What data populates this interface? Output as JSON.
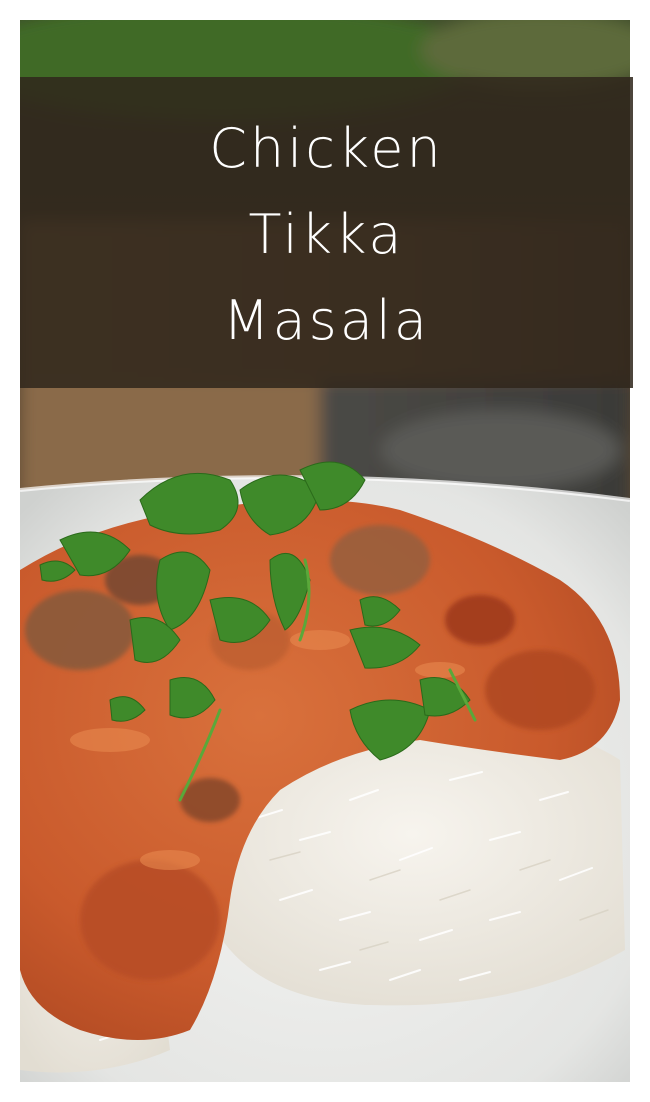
{
  "pin": {
    "title_lines": [
      "Chicken",
      "Tikka",
      "Masala"
    ]
  },
  "colors": {
    "banner_background": "#30261c",
    "title_text": "#ffffff",
    "page_background": "#ffffff",
    "sauce": "#c8552a",
    "rice": "#f2efe8",
    "cilantro": "#3f8a2a"
  },
  "photo": {
    "icon": "food-photo"
  }
}
